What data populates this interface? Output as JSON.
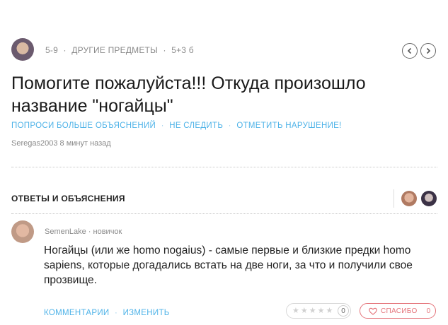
{
  "header": {
    "grade": "5-9",
    "subject": "ДРУГИЕ ПРЕДМЕТЫ",
    "points": "5+3 б",
    "sep": "·"
  },
  "question": {
    "title": "Помогите пожалуйста!!! Откуда произошло название \"ногайцы\""
  },
  "question_actions": {
    "ask_more": "ПОПРОСИ БОЛЬШЕ ОБЪЯСНЕНИЙ",
    "unfollow": "НЕ СЛЕДИТЬ",
    "report": "ОТМЕТИТЬ НАРУШЕНИЕ!",
    "sep": "·"
  },
  "asked_by": {
    "user": "Seregas2003",
    "time": "8 минут назад"
  },
  "answers_section": {
    "title": "ОТВЕТЫ И ОБЪЯСНЕНИЯ"
  },
  "answer": {
    "author": "SemenLake",
    "rank": "новичок",
    "sep": "·",
    "text": "Ногайцы (или же homo nogaius) - самые первые и близкие предки homo sapiens, которые догадались встать на две ноги, за что и получили свое прозвище.",
    "comments_label": "КОММЕНТАРИИ",
    "edit_label": "ИЗМЕНИТЬ",
    "rating_count": "0",
    "rating_stars": 0,
    "thanks_label": "СПАСИБО",
    "thanks_count": "0"
  },
  "colors": {
    "link": "#4fb3e8",
    "thanks": "#e4737a",
    "muted": "#8a8a8a"
  },
  "icons": {
    "prev": "chevron-left-icon",
    "next": "chevron-right-icon",
    "star": "star-icon",
    "heart": "heart-icon"
  }
}
